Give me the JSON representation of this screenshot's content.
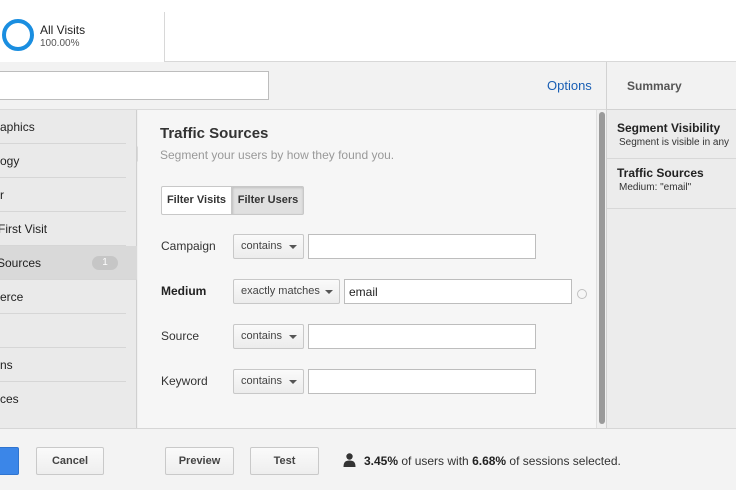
{
  "segment_card": {
    "name": "All Visits",
    "percent": "100.00%",
    "ring_color": "#1a8ee0"
  },
  "name_bar": {
    "name_value": "",
    "options_label": "Options"
  },
  "summary": {
    "title": "Summary",
    "items": [
      {
        "heading": "Segment Visibility",
        "detail": "Segment is visible in any"
      },
      {
        "heading": "Traffic Sources",
        "detail": "Medium: \"email\""
      }
    ]
  },
  "sidebar": {
    "items": [
      {
        "label": "aphics"
      },
      {
        "label": "ogy"
      },
      {
        "label": "r"
      },
      {
        "label": "First Visit"
      },
      {
        "label": "Sources",
        "badge": "1",
        "active": true
      },
      {
        "label": "erce"
      },
      {
        "label": "ns"
      },
      {
        "label": "ces"
      }
    ]
  },
  "main": {
    "title": "Traffic Sources",
    "subtitle": "Segment your users by how they found you.",
    "toggle": {
      "visits": "Filter Visits",
      "users": "Filter Users",
      "selected": "Filter Users"
    },
    "filters": [
      {
        "label": "Campaign",
        "operator": "contains",
        "value": ""
      },
      {
        "label": "Medium",
        "operator": "exactly matches",
        "value": "email",
        "bold": true
      },
      {
        "label": "Source",
        "operator": "contains",
        "value": ""
      },
      {
        "label": "Keyword",
        "operator": "contains",
        "value": ""
      }
    ]
  },
  "footer": {
    "cancel_label": "Cancel",
    "preview_label": "Preview",
    "test_label": "Test",
    "users_pct": "3.45%",
    "users_text": " of users with ",
    "sessions_pct": "6.68%",
    "sessions_text": " of sessions selected."
  },
  "colors": {
    "accent": "#1a8ee0",
    "link": "#1a5fb4",
    "save_button": "#3b86e8"
  }
}
